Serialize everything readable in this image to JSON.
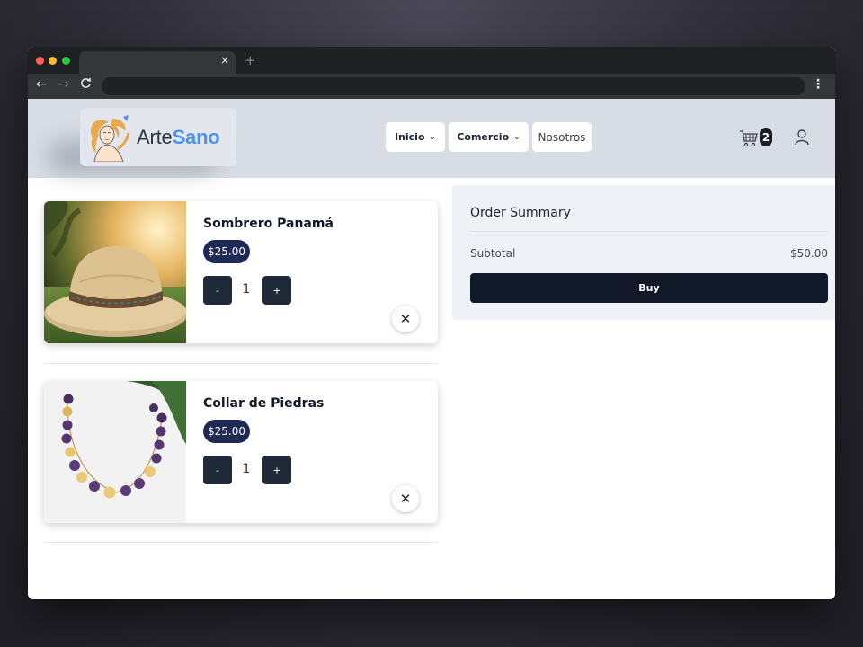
{
  "browser": {
    "tab_close_glyph": "×",
    "new_tab_glyph": "+",
    "back_glyph": "←",
    "forward_glyph": "→",
    "reload_glyph": "C",
    "menu_glyph": "⋮"
  },
  "header": {
    "logo_text_part1": "Arte",
    "logo_text_part2": "Sano",
    "nav": [
      {
        "label": "Inicio",
        "has_dropdown": true
      },
      {
        "label": "Comercio",
        "has_dropdown": true
      },
      {
        "label": "Nosotros",
        "has_dropdown": false
      }
    ],
    "chevron_glyph": "⌄",
    "cart_count": "2",
    "cart_icon": "cart-icon",
    "user_icon": "user-icon"
  },
  "cart": {
    "items": [
      {
        "name": "Sombrero Panamá",
        "price": "$25.00",
        "quantity": "1",
        "minus": "-",
        "plus": "+",
        "remove": "✕",
        "image": "straw-hat"
      },
      {
        "name": "Collar de Piedras",
        "price": "$25.00",
        "quantity": "1",
        "minus": "-",
        "plus": "+",
        "remove": "✕",
        "image": "beaded-necklace"
      }
    ]
  },
  "summary": {
    "title": "Order Summary",
    "subtotal_label": "Subtotal",
    "subtotal_value": "$50.00",
    "buy_label": "Buy"
  },
  "colors": {
    "header_bg": "#d8dde5",
    "accent_blue": "#4f93e9",
    "price_pill": "#1e2a55",
    "button_dark": "#1f2937",
    "buy_button": "#111827"
  }
}
